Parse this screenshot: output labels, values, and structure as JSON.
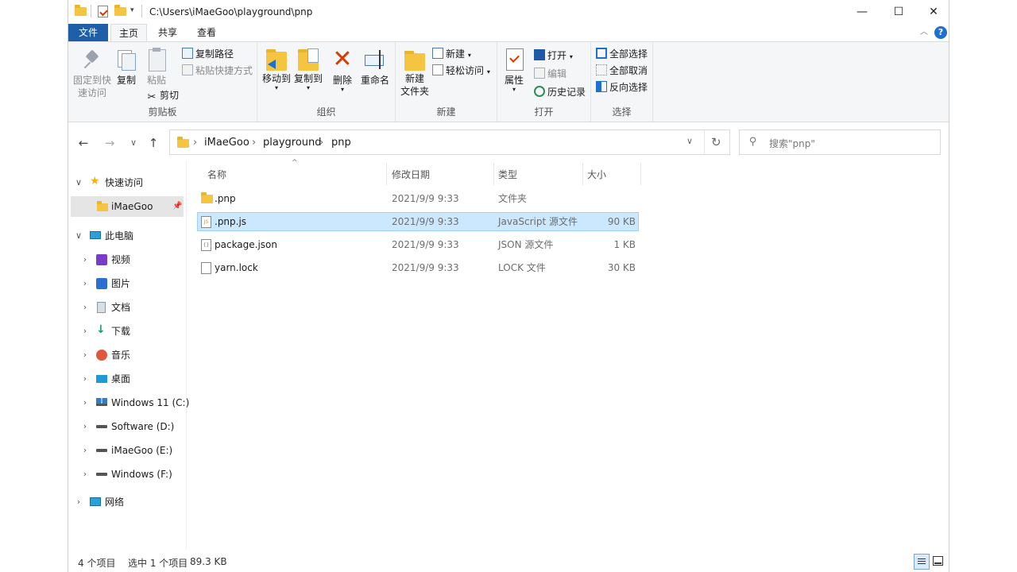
{
  "window": {
    "path": "C:\\Users\\iMaeGoo\\playground\\pnp",
    "controls": {
      "minimize": "—",
      "maximize": "☐",
      "close": "✕"
    }
  },
  "tabs": {
    "file": "文件",
    "home": "主页",
    "share": "共享",
    "view": "查看",
    "help": "?"
  },
  "ribbon": {
    "clipboard": {
      "name": "剪贴板",
      "pin": [
        "固定到快",
        "速访问"
      ],
      "copy": "复制",
      "paste": "粘贴",
      "copy_path": "复制路径",
      "paste_shortcut": "粘贴快捷方式",
      "cut": "剪切"
    },
    "organize": {
      "name": "组织",
      "move_to": "移动到",
      "copy_to": "复制到",
      "delete": "删除",
      "rename": "重命名"
    },
    "new": {
      "name": "新建",
      "new_folder": [
        "新建",
        "文件夹"
      ],
      "new_item": "新建",
      "easy_access": "轻松访问"
    },
    "open": {
      "name": "打开",
      "properties": "属性",
      "open": "打开",
      "edit": "编辑",
      "history": "历史记录"
    },
    "select": {
      "name": "选择",
      "select_all": "全部选择",
      "select_none": "全部取消",
      "invert": "反向选择"
    }
  },
  "address": {
    "crumbs": [
      "iMaeGoo",
      "playground",
      "pnp"
    ],
    "sep": "›",
    "search_placeholder": "搜索\"pnp\""
  },
  "navpane": {
    "quick_access": "快速访问",
    "pinned": "iMaeGoo",
    "this_pc": "此电脑",
    "items": [
      "视频",
      "图片",
      "文档",
      "下载",
      "音乐",
      "桌面",
      "Windows 11 (C:)",
      "Software (D:)",
      "iMaeGoo (E:)",
      "Windows (F:)"
    ],
    "network": "网络"
  },
  "columns": {
    "name": "名称",
    "modified": "修改日期",
    "type": "类型",
    "size": "大小"
  },
  "files": [
    {
      "name": ".pnp",
      "modified": "2021/9/9 9:33",
      "type": "文件夹",
      "size": ""
    },
    {
      "name": ".pnp.js",
      "modified": "2021/9/9 9:33",
      "type": "JavaScript 源文件",
      "size": "90 KB"
    },
    {
      "name": "package.json",
      "modified": "2021/9/9 9:33",
      "type": "JSON 源文件",
      "size": "1 KB"
    },
    {
      "name": "yarn.lock",
      "modified": "2021/9/9 9:33",
      "type": "LOCK 文件",
      "size": "30 KB"
    }
  ],
  "status": {
    "count": "4 个项目",
    "selected": "选中 1 个项目",
    "size": "89.3 KB"
  },
  "colors": {
    "accent": "#1f5fa8",
    "selection": "#cce8ff",
    "folder": "#f5c542",
    "delete_red": "#d83b01"
  }
}
